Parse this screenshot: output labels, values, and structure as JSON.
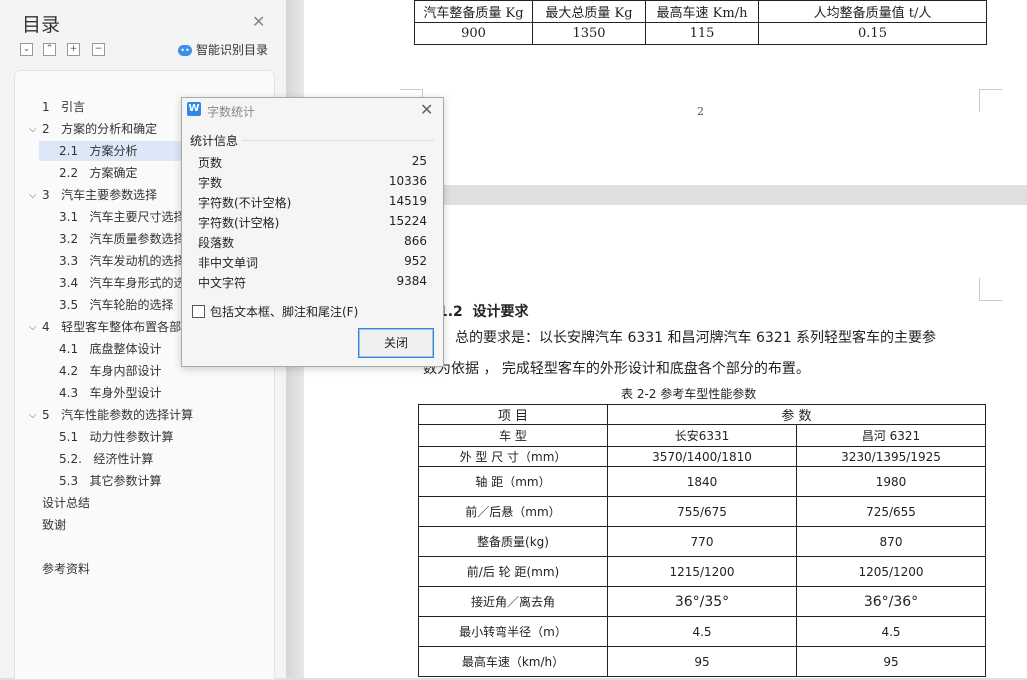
{
  "toc": {
    "title": "目录",
    "close_glyph": "✕",
    "toolbar": [
      "expand-all",
      "collapse",
      "add",
      "remove"
    ],
    "smart_label": "智能识别目录",
    "items": [
      {
        "num": "1",
        "label": "引言"
      },
      {
        "num": "2",
        "label": "方案的分析和确定"
      },
      {
        "num": "2.1",
        "label": "方案分析"
      },
      {
        "num": "2.2",
        "label": "方案确定"
      },
      {
        "num": "3",
        "label": "汽车主要参数选择"
      },
      {
        "num": "3.1",
        "label": "汽车主要尺寸选择"
      },
      {
        "num": "3.2",
        "label": "汽车质量参数选择"
      },
      {
        "num": "3.3",
        "label": "汽车发动机的选择"
      },
      {
        "num": "3.4",
        "label": "汽车车身形式的选择"
      },
      {
        "num": "3.5",
        "label": "汽车轮胎的选择"
      },
      {
        "num": "4",
        "label": "轻型客车整体布置各部"
      },
      {
        "num": "4.1",
        "label": "底盘整体设计"
      },
      {
        "num": "4.2",
        "label": "车身内部设计"
      },
      {
        "num": "4.3",
        "label": "车身外型设计"
      },
      {
        "num": "5",
        "label": "汽车性能参数的选择计算"
      },
      {
        "num": "5.1",
        "label": "动力性参数计算"
      },
      {
        "num": "5.2.",
        "label": "经济性计算"
      },
      {
        "num": "5.3",
        "label": "其它参数计算"
      },
      {
        "num": "",
        "label": "设计总结"
      },
      {
        "num": "",
        "label": "致谢"
      },
      {
        "num": "",
        "label": "参考资料"
      }
    ]
  },
  "doc": {
    "top_table": {
      "headers": [
        "汽车整备质量 Kg",
        "最大总质量 Kg",
        "最高车速 Km/h",
        "人均整备质量值 t/人"
      ],
      "row": [
        "900",
        "1350",
        "115",
        "0.15"
      ]
    },
    "page_number": "2",
    "section_heading": "1.2  设计要求",
    "para_line1": "总的要求是：以长安牌汽车 6331 和昌河牌汽车 6321 系列轻型客车的主要参",
    "para_line2": "数为依据 ， 完成轻型客车的外形设计和底盘各个部分的布置。",
    "table_caption": "表 2-2 参考车型性能参数",
    "table": {
      "head1": [
        "项 目",
        "参 数"
      ],
      "head2": [
        "车 型",
        "长安6331",
        "昌河 6321"
      ],
      "rows": [
        [
          "外 型 尺 寸（mm）",
          "3570/1400/1810",
          "3230/1395/1925"
        ],
        [
          "轴 距（mm）",
          "1840",
          "1980"
        ],
        [
          "前／后悬（mm）",
          "755/675",
          "725/655"
        ],
        [
          "整备质量(kg)",
          "770",
          "870"
        ],
        [
          "前/后 轮 距(mm)",
          "1215/1200",
          "1205/1200"
        ],
        [
          "接近角／离去角",
          "36°/35°",
          "36°/36°"
        ],
        [
          "最小转弯半径（m）",
          "4.5",
          "4.5"
        ],
        [
          "最高车速（km/h）",
          "95",
          "95"
        ]
      ]
    }
  },
  "dialog": {
    "title": "字数统计",
    "close_glyph": "✕",
    "section": "统计信息",
    "stats": [
      {
        "label": "页数",
        "value": "25"
      },
      {
        "label": "字数",
        "value": "10336"
      },
      {
        "label": "字符数(不计空格)",
        "value": "14519"
      },
      {
        "label": "字符数(计空格)",
        "value": "15224"
      },
      {
        "label": "段落数",
        "value": "866"
      },
      {
        "label": "非中文单词",
        "value": "952"
      },
      {
        "label": "中文字符",
        "value": "9384"
      }
    ],
    "checkbox_label": "包括文本框、脚注和尾注(F)",
    "close_button": "关闭"
  }
}
